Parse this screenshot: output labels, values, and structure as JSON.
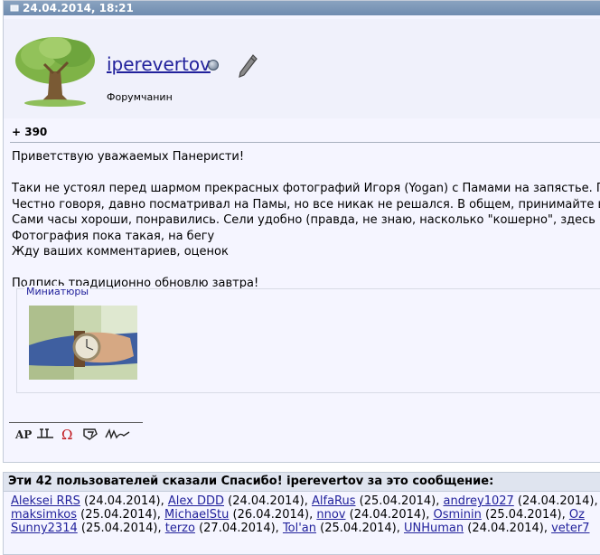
{
  "post": {
    "date": "24.04.2014, 18:21",
    "user": {
      "name": "iperevertov",
      "title": "Форумчанин"
    },
    "reputation": "+ 390",
    "lines": [
      "Приветствую уважаемых Панеристи!",
      "",
      "Таки не устоял перед шармом прекрасных фотографий Игоря (Yogan) с Памами на запястье. По",
      "Честно говоря, давно посматривал на Памы, но все никак не решался. В общем, принимайте в",
      "Сами часы хороши, понравились. Сели удобно (правда, не знаю, насколько \"кошерно\", здесь п",
      "Фотография пока такая, на бегу",
      "Жду ваших комментариев, оценок",
      "",
      "Подпись традиционно обновлю завтра!"
    ],
    "thumbnails_title": "Миниатюры"
  },
  "thanks": {
    "header": "Эти 42 пользователей сказали Спасибо! iperevertov за это сообщение:",
    "rows": [
      [
        {
          "name": "Aleksei RRS",
          "date": " (24.04.2014), "
        },
        {
          "name": "Alex DDD",
          "date": " (24.04.2014), "
        },
        {
          "name": "AlfaRus",
          "date": " (25.04.2014), "
        },
        {
          "name": "andrey1027",
          "date": " (24.04.2014), "
        }
      ],
      [
        {
          "name": "maksimkos",
          "date": " (25.04.2014), "
        },
        {
          "name": "MichaelStu",
          "date": " (26.04.2014), "
        },
        {
          "name": "nnov",
          "date": " (24.04.2014), "
        },
        {
          "name": "Osminin",
          "date": " (25.04.2014), "
        },
        {
          "name": "Oz",
          "date": ""
        }
      ],
      [
        {
          "name": "Sunny2314",
          "date": " (25.04.2014), "
        },
        {
          "name": "terzo",
          "date": " (27.04.2014), "
        },
        {
          "name": "Tol'an",
          "date": " (25.04.2014), "
        },
        {
          "name": "UNHuman",
          "date": " (24.04.2014), "
        },
        {
          "name": "veter7",
          "date": ""
        }
      ]
    ]
  },
  "icons": [
    "pin-icon",
    "status-offline-icon",
    "edit-pencil-icon",
    "ap-icon",
    "jl-icon",
    "omega-icon",
    "monogram-icon",
    "signature-icon"
  ]
}
